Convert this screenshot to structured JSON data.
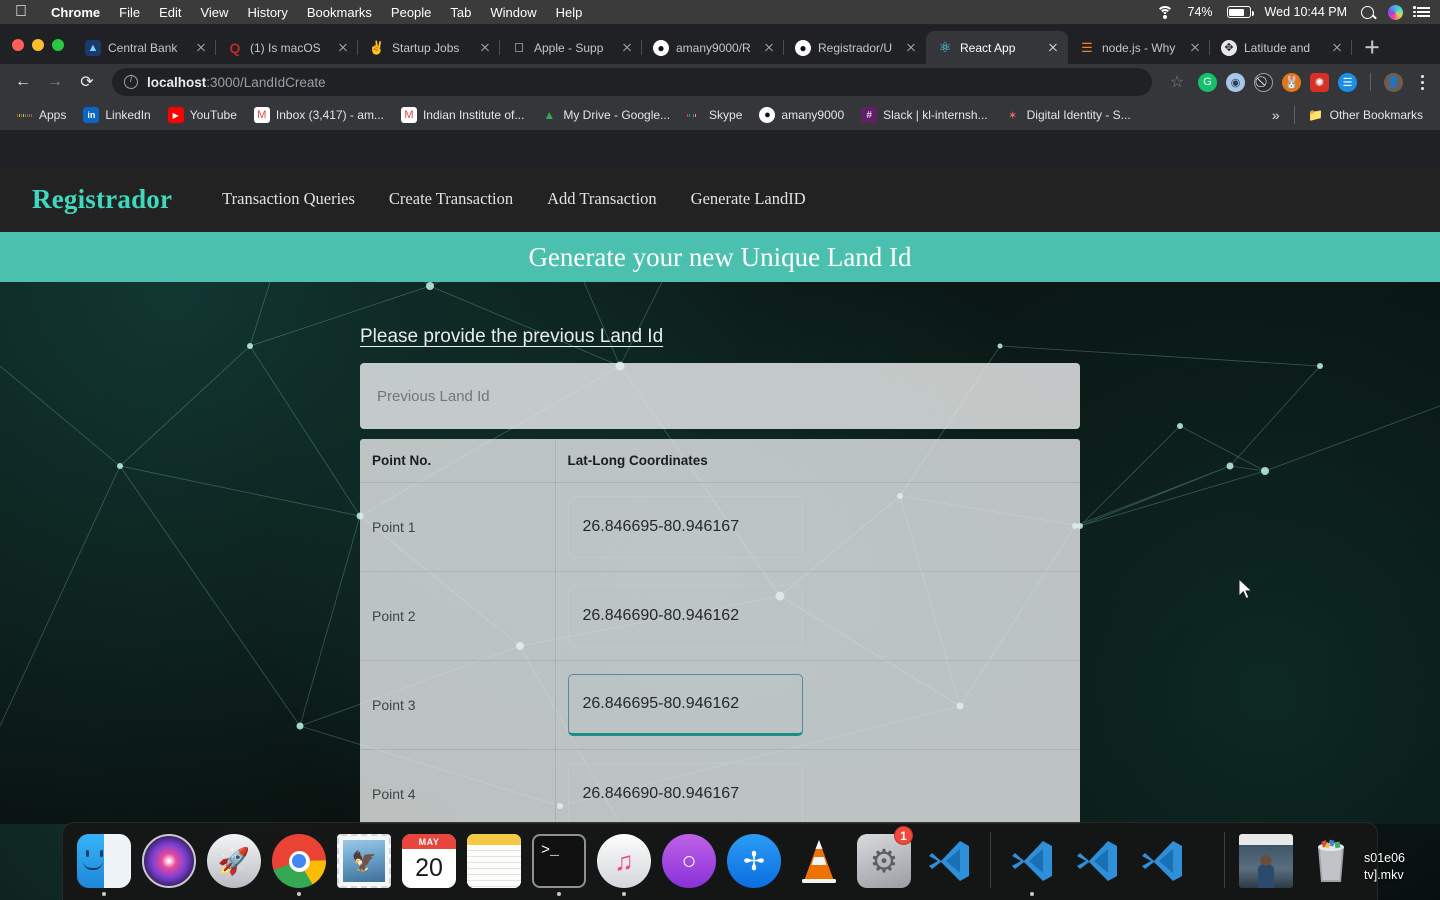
{
  "menubar": {
    "apple_icon": "apple-logo-icon",
    "items": [
      "Chrome",
      "File",
      "Edit",
      "View",
      "History",
      "Bookmarks",
      "People",
      "Tab",
      "Window",
      "Help"
    ],
    "status": {
      "wifi_icon": "wifi-icon",
      "battery_percent": "74%",
      "battery_icon": "battery-icon",
      "clock": "Wed 10:44 PM",
      "search_icon": "spotlight-search-icon",
      "siri_icon": "siri-icon",
      "control_center_icon": "control-center-icon"
    }
  },
  "browser": {
    "window_controls": [
      "close",
      "minimize",
      "zoom"
    ],
    "tabs": [
      {
        "title": "Central Bank",
        "favicon": "bank-icon",
        "active": false
      },
      {
        "title": "(1) Is macOS",
        "favicon": "quora-icon",
        "active": false
      },
      {
        "title": "Startup Jobs",
        "favicon": "angellist-icon",
        "active": false
      },
      {
        "title": "Apple - Supp",
        "favicon": "apple-icon",
        "active": false
      },
      {
        "title": "amany9000/R",
        "favicon": "github-icon",
        "active": false
      },
      {
        "title": "Registrador/U",
        "favicon": "github-icon",
        "active": false
      },
      {
        "title": "React App",
        "favicon": "react-icon",
        "active": true
      },
      {
        "title": "node.js - Why",
        "favicon": "stackoverflow-icon",
        "active": false
      },
      {
        "title": "Latitude and",
        "favicon": "safari-icon",
        "active": false
      }
    ],
    "new_tab_label": "new-tab-button",
    "toolbar": {
      "back_icon": "back-arrow-icon",
      "forward_icon": "forward-arrow-icon",
      "reload_icon": "reload-icon",
      "site_info_icon": "site-info-icon",
      "url_host": "localhost",
      "url_path": ":3000/LandIdCreate",
      "bookmark_star_icon": "star-icon",
      "extensions": [
        {
          "name": "grammarly-extension-icon",
          "color": "#15c26b",
          "glyph": "G"
        },
        {
          "name": "ring-extension-icon",
          "color": "#a8c7e8",
          "glyph": "◍"
        },
        {
          "name": "dark-extension-icon",
          "color": "#2b2d30",
          "glyph": "⌀"
        },
        {
          "name": "metamask-extension-icon",
          "color": "#e2761b",
          "glyph": "🦊"
        },
        {
          "name": "red-extension-icon",
          "color": "#d93025",
          "glyph": "✺"
        },
        {
          "name": "blue-extension-icon",
          "color": "#1a8fe3",
          "glyph": "▤"
        }
      ],
      "profile_icon": "profile-avatar-icon",
      "menu_icon": "three-dot-menu-icon"
    },
    "bookmarks": [
      {
        "label": "Apps",
        "icon": "apps-grid-icon"
      },
      {
        "label": "LinkedIn",
        "icon": "linkedin-icon"
      },
      {
        "label": "YouTube",
        "icon": "youtube-icon"
      },
      {
        "label": "Inbox (3,417) - am...",
        "icon": "gmail-icon"
      },
      {
        "label": "Indian Institute of...",
        "icon": "gmail-icon"
      },
      {
        "label": "My Drive - Google...",
        "icon": "google-drive-icon"
      },
      {
        "label": "Skype",
        "icon": "skype-icon"
      },
      {
        "label": "amany9000",
        "icon": "github-icon"
      },
      {
        "label": "Slack | kl-internsh...",
        "icon": "slack-icon"
      },
      {
        "label": "Digital Identity - S...",
        "icon": "digital-identity-icon"
      }
    ],
    "bookmarks_overflow_icon": "chevron-double-right-icon",
    "other_bookmarks": {
      "label": "Other Bookmarks",
      "icon": "folder-icon"
    }
  },
  "app": {
    "brand": "Registrador",
    "nav_links": [
      "Transaction Queries",
      "Create Transaction",
      "Add Transaction",
      "Generate LandID"
    ],
    "banner_title": "Generate your new Unique Land Id",
    "accent_color": "#4cc0ae",
    "brand_color": "#3ed9bf",
    "form": {
      "heading": "Please provide the previous Land Id",
      "previous_land_id": {
        "value": "",
        "placeholder": "Previous Land Id"
      },
      "table": {
        "columns": [
          "Point No.",
          "Lat-Long Coordinates"
        ],
        "rows": [
          {
            "point": "Point 1",
            "coordinate": "26.846695-80.946167",
            "focused": false
          },
          {
            "point": "Point 2",
            "coordinate": "26.846690-80.946162",
            "focused": false
          },
          {
            "point": "Point 3",
            "coordinate": "26.846695-80.946162",
            "focused": true
          },
          {
            "point": "Point 4",
            "coordinate": "26.846690-80.946167",
            "focused": false
          }
        ]
      }
    }
  },
  "dock": {
    "items": [
      {
        "name": "finder",
        "label": "Finder",
        "running": true
      },
      {
        "name": "siri",
        "label": "Siri",
        "running": false
      },
      {
        "name": "launchpad",
        "label": "Launchpad",
        "running": false
      },
      {
        "name": "chrome",
        "label": "Google Chrome",
        "running": true
      },
      {
        "name": "mail",
        "label": "Mail",
        "running": false
      },
      {
        "name": "calendar",
        "label": "Calendar",
        "running": false,
        "month": "MAY",
        "day": "20"
      },
      {
        "name": "notes",
        "label": "Notes",
        "running": false
      },
      {
        "name": "terminal",
        "label": "Terminal",
        "running": true
      },
      {
        "name": "itunes",
        "label": "iTunes",
        "running": true
      },
      {
        "name": "podcasts",
        "label": "Podcasts",
        "running": false
      },
      {
        "name": "app-store",
        "label": "App Store",
        "running": false
      },
      {
        "name": "vlc",
        "label": "VLC",
        "running": false
      },
      {
        "name": "system-preferences",
        "label": "System Preferences",
        "running": false,
        "badge": "1"
      },
      {
        "name": "vscode",
        "label": "Visual Studio Code",
        "running": false
      },
      {
        "name": "vscode-window-1",
        "label": "Visual Studio Code",
        "running": true
      },
      {
        "name": "vscode-window-2",
        "label": "Visual Studio Code",
        "running": false
      },
      {
        "name": "vscode-window-3",
        "label": "Visual Studio Code",
        "running": false
      },
      {
        "name": "video-file",
        "label": "Video file",
        "running": false
      },
      {
        "name": "trash",
        "label": "Trash",
        "running": false
      }
    ]
  },
  "desktop": {
    "file_label_line1": "s01e06",
    "file_label_line2": "tv].mkv"
  }
}
